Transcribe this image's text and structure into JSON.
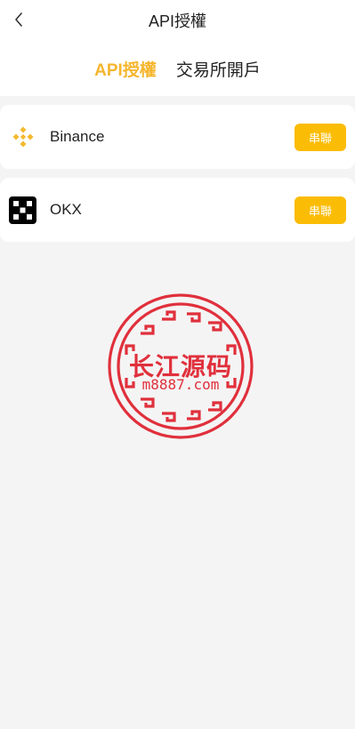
{
  "header": {
    "title": "API授權",
    "back_icon": "chevron-left-icon"
  },
  "tabs": [
    {
      "label": "API授權",
      "active": true
    },
    {
      "label": "交易所開戶",
      "active": false
    }
  ],
  "exchanges": [
    {
      "name": "Binance",
      "icon": "binance-logo-icon",
      "button_label": "串聯"
    },
    {
      "name": "OKX",
      "icon": "okx-logo-icon",
      "button_label": "串聯"
    }
  ],
  "watermark": {
    "line1": "长江源码",
    "line2": "m8887.com"
  },
  "colors": {
    "accent": "#f5b62e",
    "button": "#fbbc05",
    "background": "#f4f4f4",
    "watermark": "#e0303c"
  }
}
